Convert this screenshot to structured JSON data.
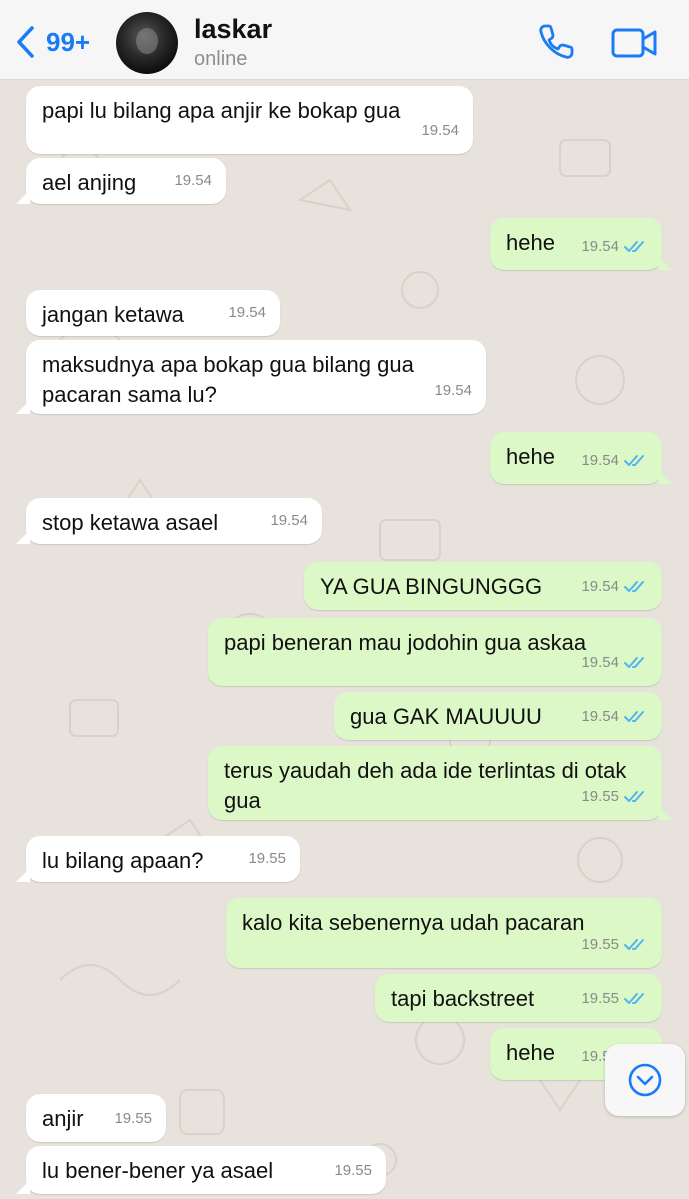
{
  "header": {
    "back_count": "99+",
    "contact_name": "laskar",
    "status": "online"
  },
  "messages": [
    {
      "dir": "in",
      "text": "papi lu bilang apa anjir ke bokap gua",
      "time": "19.54"
    },
    {
      "dir": "in",
      "text": "ael anjing",
      "time": "19.54"
    },
    {
      "dir": "out",
      "text": "hehe",
      "time": "19.54"
    },
    {
      "dir": "in",
      "text": "jangan ketawa",
      "time": "19.54"
    },
    {
      "dir": "in",
      "text": "maksudnya apa bokap gua bilang gua pacaran sama lu?",
      "time": "19.54"
    },
    {
      "dir": "out",
      "text": "hehe",
      "time": "19.54"
    },
    {
      "dir": "in",
      "text": "stop ketawa asael",
      "time": "19.54"
    },
    {
      "dir": "out",
      "text": "YA GUA BINGUNGGG",
      "time": "19.54"
    },
    {
      "dir": "out",
      "text": "papi beneran mau jodohin gua askaa",
      "time": "19.54"
    },
    {
      "dir": "out",
      "text": "gua GAK MAUUUU",
      "time": "19.54"
    },
    {
      "dir": "out",
      "text": "terus yaudah deh ada ide terlintas di otak gua",
      "time": "19.55"
    },
    {
      "dir": "in",
      "text": "lu bilang apaan?",
      "time": "19.55"
    },
    {
      "dir": "out",
      "text": "kalo kita sebenernya udah pacaran",
      "time": "19.55"
    },
    {
      "dir": "out",
      "text": "tapi backstreet",
      "time": "19.55"
    },
    {
      "dir": "out",
      "text": "hehe",
      "time": "19.55"
    },
    {
      "dir": "in",
      "text": "anjir",
      "time": "19.55"
    },
    {
      "dir": "in",
      "text": "lu bener-bener ya asael",
      "time": "19.55"
    }
  ],
  "colors": {
    "accent": "#1a7cf5",
    "incoming_bubble": "#ffffff",
    "outgoing_bubble": "#dcf8c6",
    "chat_background": "#e7e2db",
    "read_ticks": "#4fb6ec"
  },
  "icons": {
    "back": "chevron-left-icon",
    "call": "phone-icon",
    "video": "video-camera-icon",
    "scroll": "chevron-down-circle-icon"
  }
}
